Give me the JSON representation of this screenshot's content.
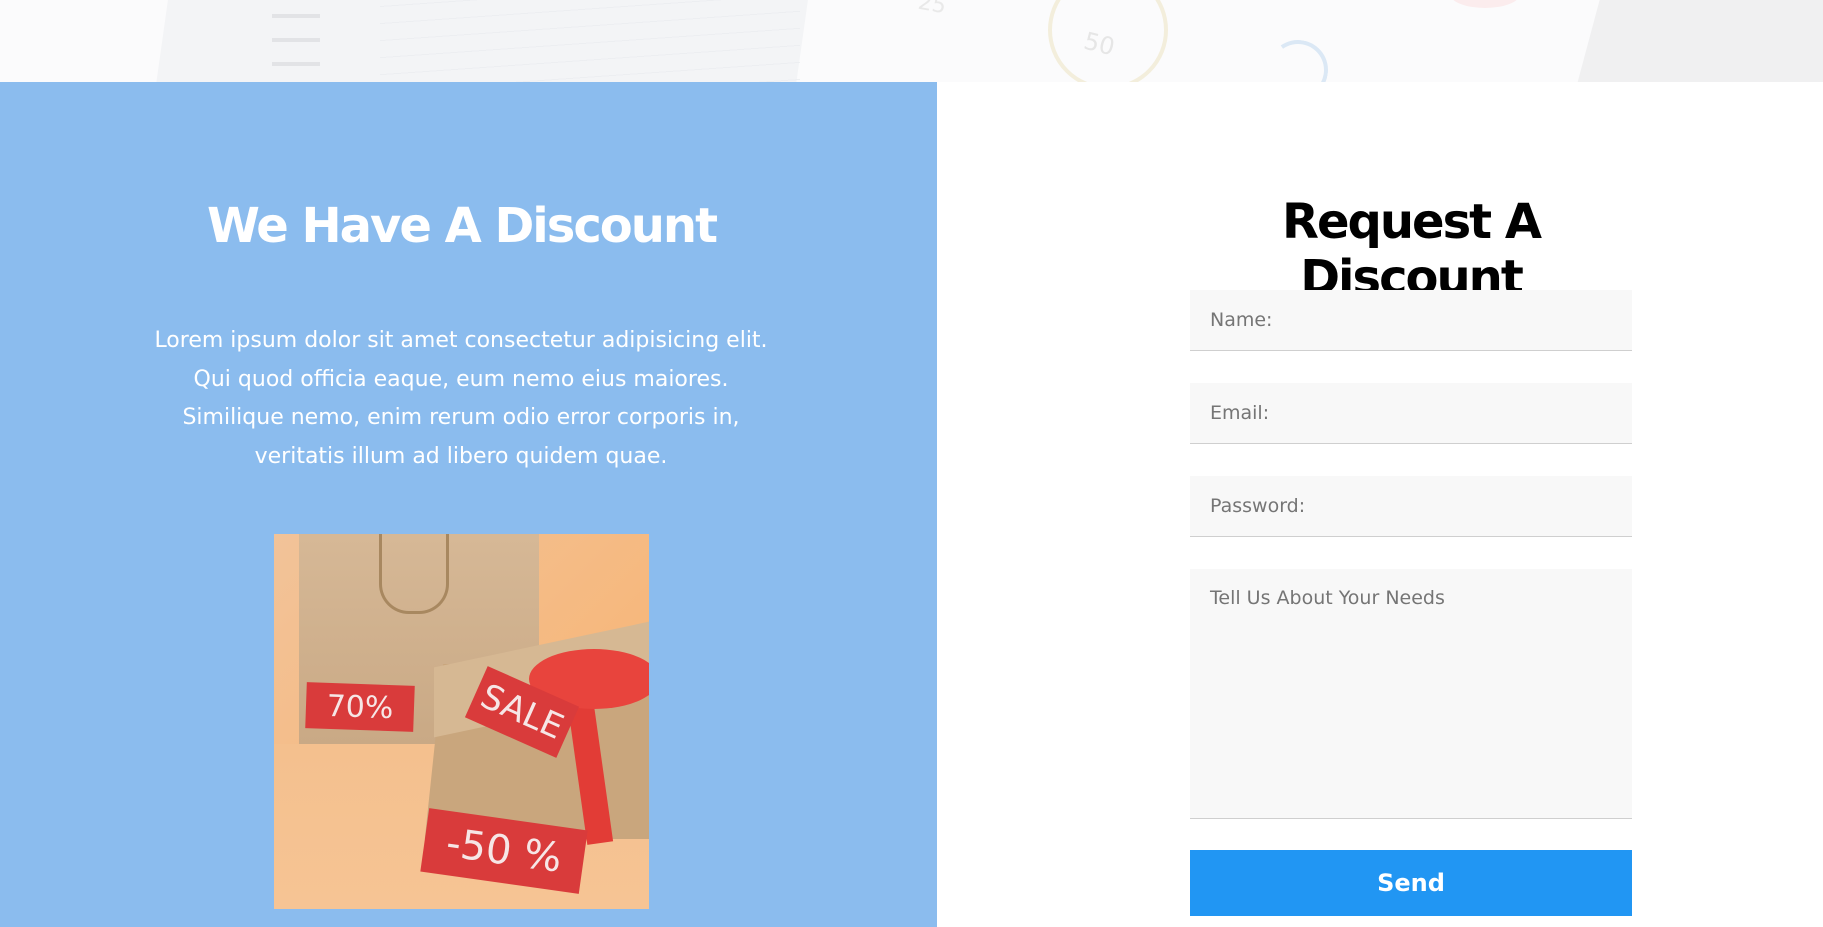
{
  "hero_strip": {
    "gauge_labels": [
      "25",
      "50"
    ]
  },
  "discount_info": {
    "title": "We Have A Discount",
    "description": "Lorem ipsum dolor sit amet consectetur adipisicing elit. Qui quod officia eaque, eum nemo eius maiores. Similique nemo, enim rerum odio error corporis in, veritatis illum ad libero quidem quae.",
    "image": {
      "tags": [
        "70%",
        "SALE",
        "-50 %"
      ]
    }
  },
  "request_form": {
    "title": "Request A Discount",
    "name_placeholder": "Name:",
    "email_placeholder": "Email:",
    "password_placeholder": "Password:",
    "needs_placeholder": "Tell Us About Your Needs",
    "send_label": "Send"
  },
  "colors": {
    "panel_blue": "#8bbcee",
    "button_blue": "#2196f3",
    "field_bg": "#f8f8f8",
    "tag_red": "#d93b3b"
  }
}
